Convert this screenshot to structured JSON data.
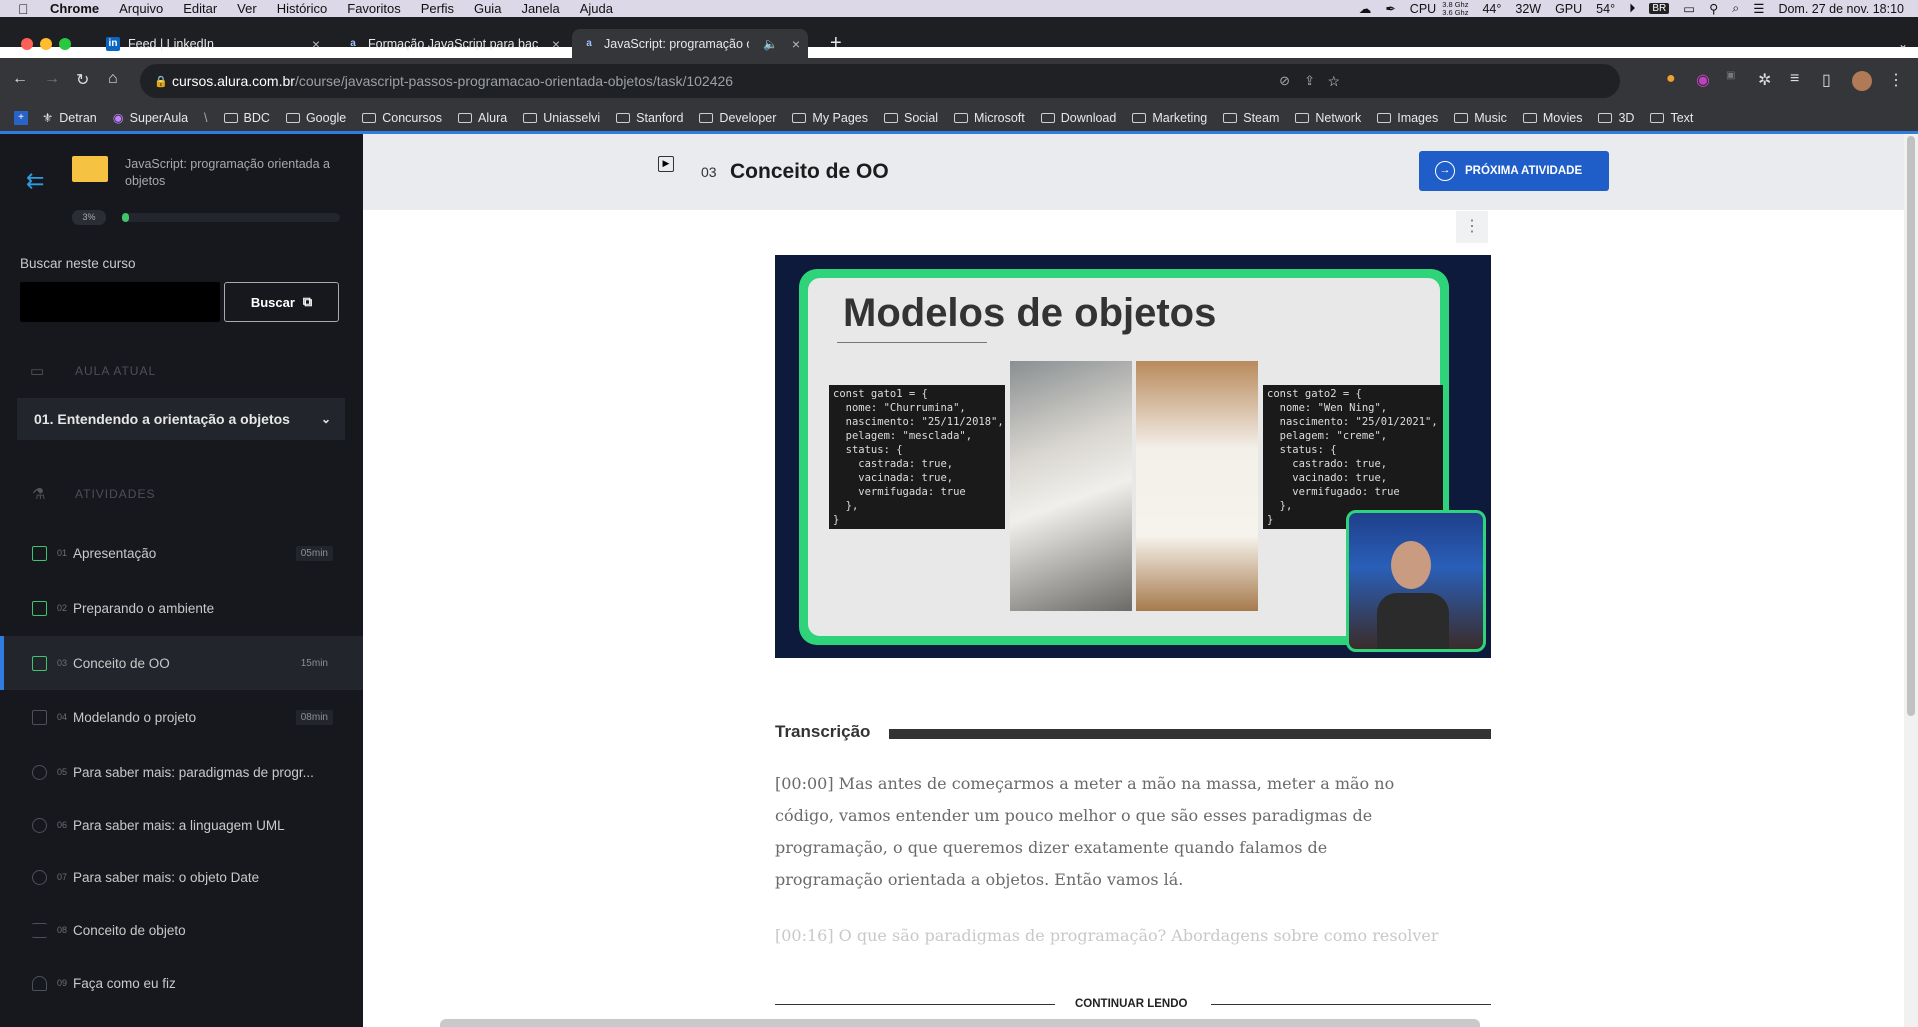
{
  "menubar": {
    "app": "Chrome",
    "items": [
      "Arquivo",
      "Editar",
      "Ver",
      "Histórico",
      "Favoritos",
      "Perfis",
      "Guia",
      "Janela",
      "Ajuda"
    ],
    "status": {
      "cpu_freq_top": "3.8 Ghz",
      "cpu_freq_bottom": "3.6 Ghz",
      "cpu_label": "CPU",
      "cpu_temp": "44°",
      "power": "32W",
      "gpu_label": "GPU",
      "gpu_temp": "54°",
      "lang": "BR",
      "datetime": "Dom. 27 de nov.  18:10"
    }
  },
  "tabs": [
    {
      "title": "Feed | LinkedIn",
      "icon": "linkedin-icon"
    },
    {
      "title": "Formação JavaScript para bac",
      "icon": "alura-icon"
    },
    {
      "title": "JavaScript: programação o",
      "icon": "alura-icon",
      "active": true
    }
  ],
  "address": {
    "host": "cursos.alura.com.br",
    "path": "/course/javascript-passos-programacao-orientada-objetos/task/102426"
  },
  "bookmarks": [
    "Detran",
    "SuperAula",
    "BDC",
    "Google",
    "Concursos",
    "Alura",
    "Uniasselvi",
    "Stanford",
    "Developer",
    "My Pages",
    "Social",
    "Microsoft",
    "Download",
    "Marketing",
    "Steam",
    "Network",
    "Images",
    "Music",
    "Movies",
    "3D",
    "Text"
  ],
  "sidebar": {
    "course_title": "JavaScript: programação orientada a objetos",
    "progress_label": "3%",
    "progress": 0.03,
    "search_label": "Buscar neste curso",
    "search_button": "Buscar",
    "current_section_heading": "AULA ATUAL",
    "current_lesson": "01. Entendendo a orientação a objetos",
    "activities_heading": "ATIVIDADES",
    "activities": [
      {
        "num": "01",
        "label": "Apresentação",
        "duration": "05min"
      },
      {
        "num": "02",
        "label": "Preparando o ambiente",
        "duration": ""
      },
      {
        "num": "03",
        "label": "Conceito de OO",
        "duration": "15min"
      },
      {
        "num": "04",
        "label": "Modelando o projeto",
        "duration": "08min"
      },
      {
        "num": "05",
        "label": "Para saber mais: paradigmas de progr...",
        "duration": ""
      },
      {
        "num": "06",
        "label": "Para saber mais: a linguagem UML",
        "duration": ""
      },
      {
        "num": "07",
        "label": "Para saber mais: o objeto Date",
        "duration": ""
      },
      {
        "num": "08",
        "label": "Conceito de objeto",
        "duration": ""
      },
      {
        "num": "09",
        "label": "Faça como eu fiz",
        "duration": ""
      }
    ]
  },
  "header": {
    "number": "03",
    "title": "Conceito de OO",
    "next_button": "PRÓXIMA ATIVIDADE"
  },
  "slide": {
    "title": "Modelos de objetos",
    "code1": [
      "const gato1 = {",
      "  nome: \"Churrumina\",",
      "  nascimento: \"25/11/2018\",",
      "  pelagem: \"mesclada\",",
      "  status: {",
      "    castrada: true,",
      "    vacinada: true,",
      "    vermifugada: true",
      "  },",
      "}"
    ],
    "code2": [
      "const gato2 = {",
      "  nome: \"Wen Ning\",",
      "  nascimento: \"25/01/2021\",",
      "  pelagem: \"creme\",",
      "  status: {",
      "    castrado: true,",
      "    vacinado: true,",
      "    vermifugado: true",
      "  },",
      "}"
    ]
  },
  "transcript": {
    "heading": "Transcrição",
    "p1": "[00:00] Mas antes de começarmos a meter a mão na massa, meter a mão no código, vamos entender um pouco melhor o que são esses paradigmas de programação, o que queremos dizer exatamente quando falamos de programação orientada a objetos. Então vamos lá.",
    "p2": "[00:16] O que são paradigmas de programação? Abordagens sobre como resolver",
    "continue": "CONTINUAR LENDO"
  }
}
